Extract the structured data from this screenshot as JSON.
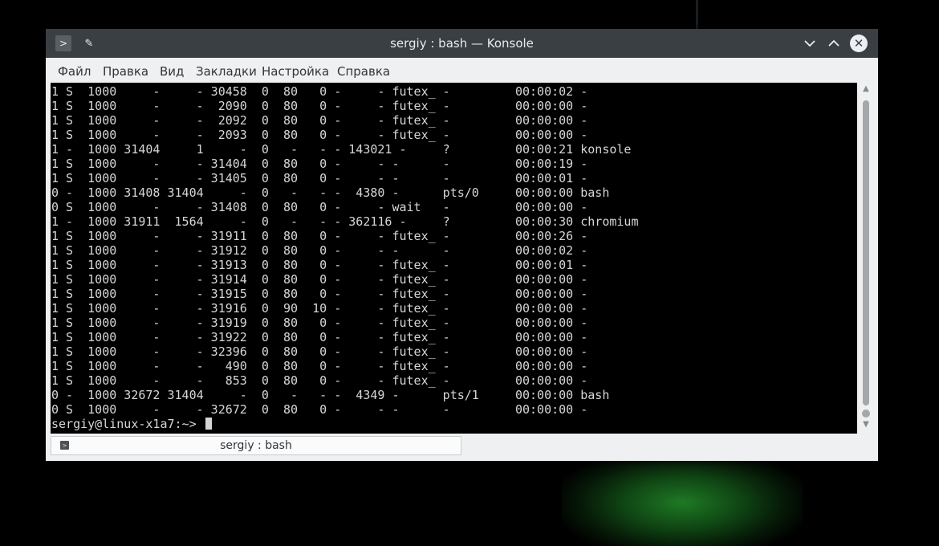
{
  "window": {
    "title": "sergiy : bash — Konsole"
  },
  "menu": [
    "Файл",
    "Правка",
    "Вид",
    "Закладки",
    "Настройка",
    "Справка"
  ],
  "terminal": {
    "lines": [
      "1 S  1000     -     - 30458  0  80   0 -     - futex_ -         00:00:02 -",
      "1 S  1000     -     -  2090  0  80   0 -     - futex_ -         00:00:00 -",
      "1 S  1000     -     -  2092  0  80   0 -     - futex_ -         00:00:00 -",
      "1 S  1000     -     -  2093  0  80   0 -     - futex_ -         00:00:00 -",
      "1 -  1000 31404     1     -  0   -   - - 143021 -     ?         00:00:21 konsole",
      "1 S  1000     -     - 31404  0  80   0 -     - -      -         00:00:19 -",
      "1 S  1000     -     - 31405  0  80   0 -     - -      -         00:00:01 -",
      "0 -  1000 31408 31404     -  0   -   - -  4380 -      pts/0     00:00:00 bash",
      "0 S  1000     -     - 31408  0  80   0 -     - wait   -         00:00:00 -",
      "1 -  1000 31911  1564     -  0   -   - - 362116 -     ?         00:00:30 chromium",
      "1 S  1000     -     - 31911  0  80   0 -     - futex_ -         00:00:26 -",
      "1 S  1000     -     - 31912  0  80   0 -     - -      -         00:00:02 -",
      "1 S  1000     -     - 31913  0  80   0 -     - futex_ -         00:00:01 -",
      "1 S  1000     -     - 31914  0  80   0 -     - futex_ -         00:00:00 -",
      "1 S  1000     -     - 31915  0  80   0 -     - futex_ -         00:00:00 -",
      "1 S  1000     -     - 31916  0  90  10 -     - futex_ -         00:00:00 -",
      "1 S  1000     -     - 31919  0  80   0 -     - futex_ -         00:00:00 -",
      "1 S  1000     -     - 31922  0  80   0 -     - futex_ -         00:00:00 -",
      "1 S  1000     -     - 32396  0  80   0 -     - futex_ -         00:00:00 -",
      "1 S  1000     -     -   490  0  80   0 -     - futex_ -         00:00:00 -",
      "1 S  1000     -     -   853  0  80   0 -     - futex_ -         00:00:00 -",
      "0 -  1000 32672 31404     -  0   -   - -  4349 -      pts/1     00:00:00 bash",
      "0 S  1000     -     - 32672  0  80   0 -     - -      -         00:00:00 -"
    ],
    "prompt": "sergiy@linux-x1a7:~> "
  },
  "tab": {
    "label": "sergiy : bash"
  },
  "colors": {
    "titlebar": "#3a3f44",
    "chrome": "#eff0f1",
    "terminal_bg": "#000000",
    "terminal_fg": "#d6d6d6"
  }
}
